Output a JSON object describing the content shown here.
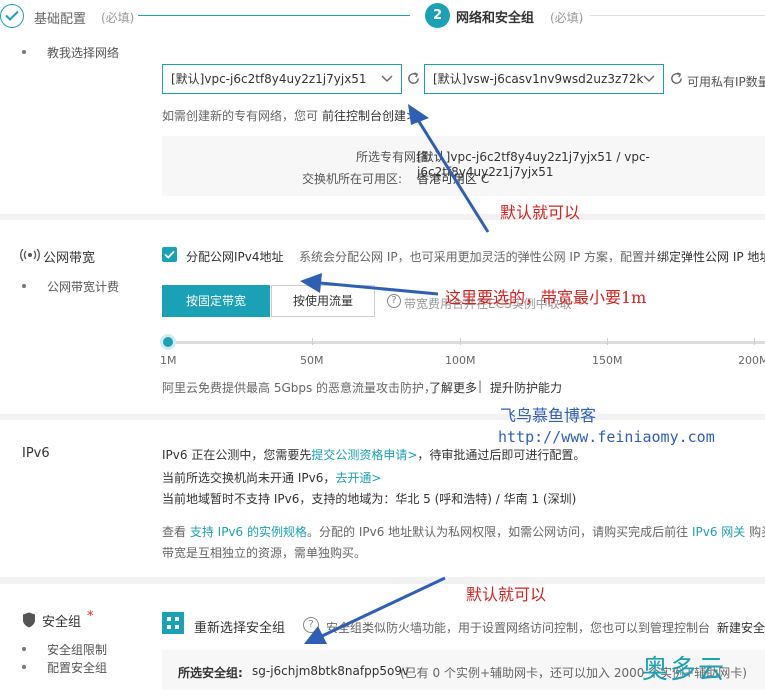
{
  "steps": [
    {
      "title": "基础配置",
      "required": "(必填)"
    },
    {
      "number": "2",
      "title": "网络和安全组",
      "required": "(必填)"
    }
  ],
  "vpc": {
    "side_label": "教我选择网络",
    "vpc_select": "[默认]vpc-j6c2tf8y4uy2z1j7yjx51",
    "vswitch_select": "[默认]vsw-j6casv1nv9wsd2uz3z72k",
    "available_ip_text": "可用私有IP数量",
    "create_hint": "如需创建新的专有网络，您可",
    "create_link": "前往控制台创建>",
    "selected_vpc_label": "所选专有网络:",
    "selected_vpc_value": "[默认]vpc-j6c2tf8y4uy2z1j7yjx51 / vpc-j6c2tf8y4uy2z1j7yjx51",
    "zone_label": "交换机所在可用区:",
    "zone_value": "香港可用区 C"
  },
  "bandwidth": {
    "section_title": "公网带宽",
    "side_sub": "公网带宽计费",
    "checkbox_label": "分配公网IPv4地址",
    "checkbox_checked": true,
    "desc": "系统会分配公网 IP，也可采用更加灵活的弹性公网 IP 方案，配置并",
    "desc_link": "绑定弹性公网 IP 地址",
    "btn_fixed": "按固定带宽",
    "btn_traffic": "按使用流量",
    "fee_note": "带宽费用合并在ECS实例中收取",
    "slider_value_mbps": 1,
    "slider_max_mbps": 200,
    "ticks": [
      "1M",
      "50M",
      "100M",
      "150M",
      "200M"
    ],
    "ddos_text": "阿里云免费提供最高 5Gbps 的恶意流量攻击防护，",
    "ddos_link1": "了解更多",
    "ddos_sep": " | ",
    "ddos_link2": "提升防护能力"
  },
  "ipv6": {
    "section_title": "IPv6",
    "line1_pre": "IPv6 正在公测中，您需要先",
    "line1_link": "提交公测资格申请>",
    "line1_post": "，待审批通过后即可进行配置。",
    "line2_pre": "当前所选交换机尚未开通 IPv6，",
    "line2_link": "去开通>",
    "line3": "当前地域暂时不支持 IPv6，支持的地域为：华北 5 (呼和浩特) / 华南 1 (深圳)",
    "line4_pre": "查看",
    "line4_link1": "支持 IPv6 的实例规格",
    "line4_mid": "。分配的 IPv6 地址默认为私网权限，如需公网访问，请购买完成后前往",
    "line4_link2": "IPv6 网关",
    "line4_post": "购买公",
    "line5": "带宽是互相独立的资源，需单独购买。"
  },
  "security_group": {
    "section_title": "安全组",
    "required_mark": "*",
    "side_items": [
      "安全组限制",
      "配置安全组"
    ],
    "reselect": "重新选择安全组",
    "desc": "安全组类似防火墙功能，用于设置网络访问控制，您也可以到管理控制台",
    "desc_link": "新建安全",
    "selected_label": "所选安全组:",
    "selected_value": "sg-j6chjm8btk8nafpp5o9v",
    "selected_note": "(已有 0 个实例+辅助网卡，还可以加入 2000 个实例+辅助网卡)"
  },
  "annotations": {
    "default_ok_1": "默认就可以",
    "bandwidth_tip": "这里要选的，带宽最小要1m",
    "blog_name": "飞鸟慕鱼博客",
    "blog_url": "http://www.feiniaomy.com",
    "default_ok_2": "默认就可以",
    "watermark": "奥多云"
  },
  "colors": {
    "accent": "#1aa1b5",
    "annotation_red": "#d6231f",
    "annotation_blue": "#2f5fb5"
  }
}
